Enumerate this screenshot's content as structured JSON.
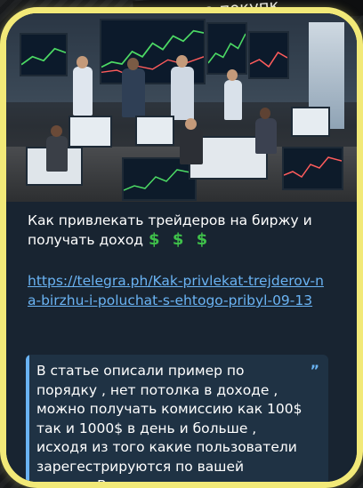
{
  "background_banner": "...вам на покупк...",
  "post": {
    "title": "Как привлекать трейдеров на биржу и получать доход",
    "emoji": "$ $ $",
    "link": "https://telegra.ph/Kak-privlekat-trejderov-na-birzhu-i-poluchat-s-ehtogo-pribyl-09-13",
    "quote_text": "В статье описали пример по порядку , нет потолка в доходе , можно получать комиссию как 100$ так и 1000$ в день и больше , исходя из того какие пользователи зарегестрируются по вашей ссылке. Время дохода"
  },
  "colors": {
    "frame": "#f2e978",
    "card_bg": "#182431",
    "link": "#6ab3f3",
    "money": "#3fc14a",
    "quote_bg": "#1f3244"
  }
}
